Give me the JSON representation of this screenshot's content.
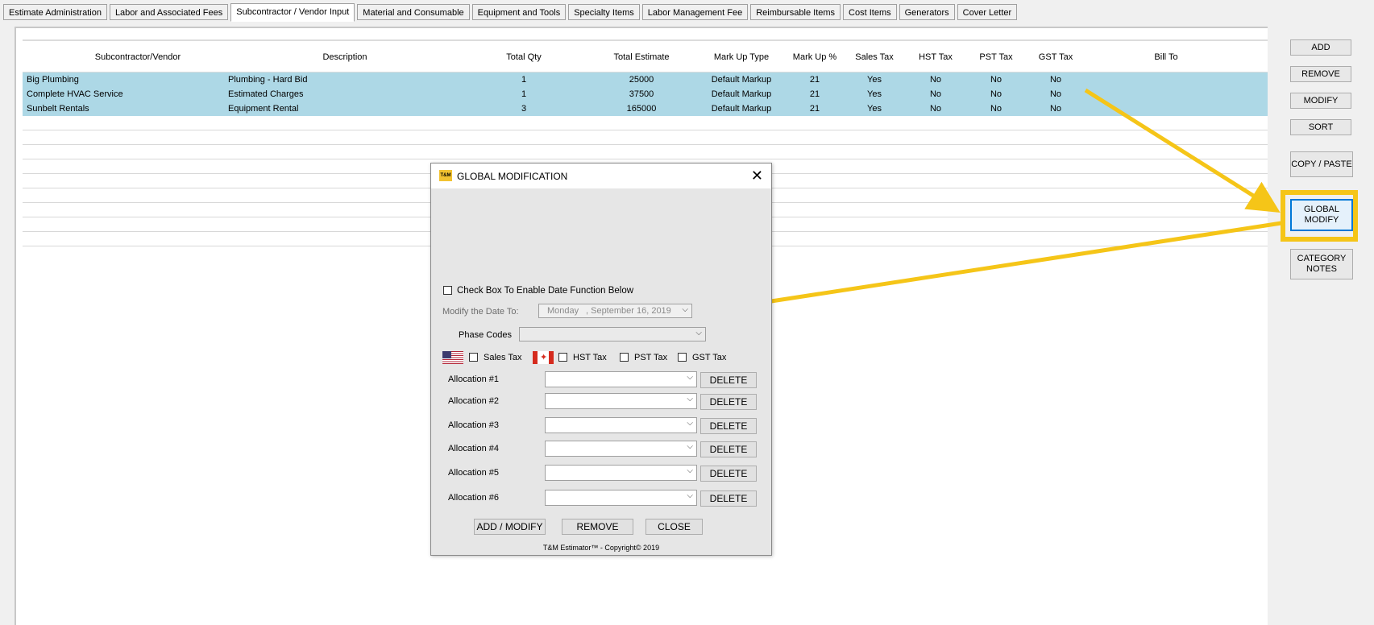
{
  "tabs": [
    "Estimate Administration",
    "Labor and Associated Fees",
    "Subcontractor / Vendor Input",
    "Material and Consumable",
    "Equipment and Tools",
    "Specialty Items",
    "Labor Management Fee",
    "Reimbursable Items",
    "Cost Items",
    "Generators",
    "Cover Letter"
  ],
  "active_tab": "Subcontractor / Vendor Input",
  "table": {
    "headers": [
      "Subcontractor/Vendor",
      "Description",
      "Total Qty",
      "Total Estimate",
      "Mark Up Type",
      "Mark Up %",
      "Sales Tax",
      "HST Tax",
      "PST Tax",
      "GST Tax",
      "Bill To"
    ],
    "rows": [
      [
        "Big Plumbing",
        "Plumbing - Hard Bid",
        "1",
        "25000",
        "Default Markup",
        "21",
        "Yes",
        "No",
        "No",
        "No",
        ""
      ],
      [
        "Complete HVAC Service",
        "Estimated Charges",
        "1",
        "37500",
        "Default Markup",
        "21",
        "Yes",
        "No",
        "No",
        "No",
        ""
      ],
      [
        "Sunbelt Rentals",
        "Equipment Rental",
        "3",
        "165000",
        "Default Markup",
        "21",
        "Yes",
        "No",
        "No",
        "No",
        ""
      ]
    ]
  },
  "side_buttons": [
    "ADD",
    "REMOVE",
    "MODIFY",
    "SORT",
    "COPY / PASTE",
    "GLOBAL MODIFY",
    "CATEGORY NOTES"
  ],
  "dialog": {
    "logo": "T&M",
    "title": "GLOBAL MODIFICATION",
    "close": "✕",
    "date_checkbox_label": "Check Box To Enable Date Function Below",
    "date_label": "Modify the Date To:",
    "date_day": "Monday",
    "date_value": ", September 16, 2019",
    "phase_label": "Phase Codes",
    "sales_tax": "Sales Tax",
    "hst_tax": "HST Tax",
    "pst_tax": "PST Tax",
    "gst_tax": "GST Tax",
    "allocations": [
      "Allocation #1",
      "Allocation #2",
      "Allocation #3",
      "Allocation #4",
      "Allocation #5",
      "Allocation #6"
    ],
    "delete_label": "DELETE",
    "add_modify": "ADD / MODIFY",
    "remove": "REMOVE",
    "close_btn": "CLOSE",
    "copyright": "T&M Estimator™ - Copyright© 2019"
  },
  "colors": {
    "row_selected": "#add8e6",
    "highlight": "#f5c518",
    "logo": "#f2c231"
  }
}
